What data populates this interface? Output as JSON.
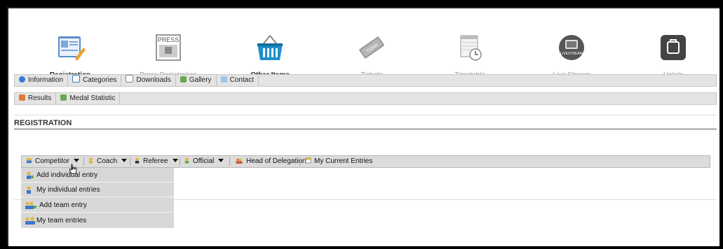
{
  "modules": [
    {
      "label": "Registration",
      "icon": "registration-form-icon",
      "active": true
    },
    {
      "label": "Press Registration",
      "icon": "press-newspaper-icon",
      "active": false
    },
    {
      "label": "Other Items",
      "icon": "shopping-basket-icon",
      "active": true
    },
    {
      "label": "Tickets",
      "icon": "ticket-icon",
      "active": false
    },
    {
      "label": "Timetable",
      "icon": "timetable-clock-icon",
      "active": false
    },
    {
      "label": "Live Stream",
      "icon": "livestream-tv-icon",
      "active": false
    },
    {
      "label": "Hotels",
      "icon": "hotel-suitcase-icon",
      "active": false
    }
  ],
  "nav1": [
    {
      "label": "Information",
      "icon": "info-icon",
      "color": "#3a78c9"
    },
    {
      "label": "Categories",
      "icon": "folder-icon",
      "color": "#e0b640"
    },
    {
      "label": "Downloads",
      "icon": "document-icon",
      "color": "#ffffff"
    },
    {
      "label": "Gallery",
      "icon": "image-icon",
      "color": "#6aa84f"
    },
    {
      "label": "Contact",
      "icon": "envelope-icon",
      "color": "#9ec5e8"
    }
  ],
  "nav2": [
    {
      "label": "Results",
      "icon": "trophy-icon",
      "color": "#e07b39"
    },
    {
      "label": "Medal Statistic",
      "icon": "chart-icon",
      "color": "#6aa84f"
    }
  ],
  "section": {
    "title": "REGISTRATION"
  },
  "menubar": {
    "competitor": "Competitor",
    "coach": "Coach",
    "referee": "Referee",
    "official": "Official",
    "head": "Head of Delegation",
    "entries": "My Current Entries"
  },
  "dropdown": [
    {
      "label": "Add individual entry",
      "icon": "user-add-icon"
    },
    {
      "label": "My individual entries",
      "icon": "user-icon"
    },
    {
      "label": "Add team entry",
      "icon": "team-add-icon"
    },
    {
      "label": "My team entries",
      "icon": "team-icon"
    }
  ],
  "colors": {
    "accent": "#e0b640",
    "bar": "#e4e4e4"
  }
}
